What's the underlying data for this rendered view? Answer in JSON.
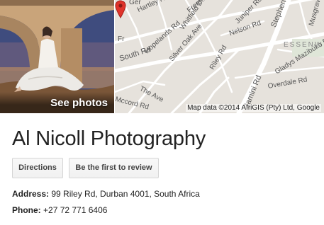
{
  "media": {
    "see_photos_label": "See photos",
    "map": {
      "attribution": "Map data ©2014 AfriGIS (Pty) Ltd, Google",
      "district": "ESSENW",
      "streets": [
        "South Rd",
        "Hopelands Rd",
        "Silver Oak Ave",
        "Whitfield Dr",
        "Frere Rd",
        "Juniper Rd",
        "Nelson Rd",
        "Riley Rd",
        "Stephen",
        "Gladys Mazibuko Rd",
        "Overdale Rd",
        "Mccord Rd",
        "The Ave",
        "Musgrave",
        "Jamini Rd",
        "Hartley Rd",
        "Ger",
        "Fr"
      ]
    }
  },
  "business": {
    "name": "Al Nicoll Photography",
    "actions": {
      "directions_label": "Directions",
      "review_label": "Be the first to review"
    },
    "address": {
      "key": "Address:",
      "value": "99 Riley Rd, Durban 4001, South Africa"
    },
    "phone": {
      "key": "Phone:",
      "value": "+27 72 771 6406"
    }
  },
  "colors": {
    "map_background": "#e6e2dc",
    "map_road": "#ffffff",
    "pin": "#e0342b",
    "button_border": "#d5d5d5",
    "text": "#222222"
  }
}
